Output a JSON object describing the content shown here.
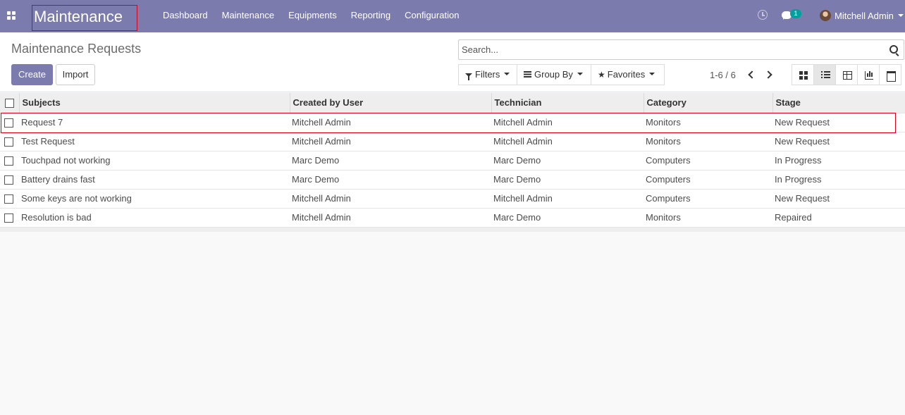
{
  "navbar": {
    "brand": "Maintenance",
    "menu": [
      "Dashboard",
      "Maintenance",
      "Equipments",
      "Reporting",
      "Configuration"
    ],
    "messages_count": "1",
    "user_name": "Mitchell Admin",
    "bg_color": "#7c7bad"
  },
  "control_panel": {
    "title": "Maintenance Requests",
    "create_label": "Create",
    "import_label": "Import",
    "search_placeholder": "Search...",
    "filters_label": "Filters",
    "groupby_label": "Group By",
    "favorites_label": "Favorites",
    "pager": "1-6 / 6",
    "views": [
      "kanban",
      "list",
      "pivot",
      "graph",
      "calendar"
    ],
    "active_view": "list"
  },
  "table": {
    "columns": [
      "Subjects",
      "Created by User",
      "Technician",
      "Category",
      "Stage"
    ],
    "rows": [
      [
        "Request 7",
        "Mitchell Admin",
        "Mitchell Admin",
        "Monitors",
        "New Request"
      ],
      [
        "Test Request",
        "Mitchell Admin",
        "Mitchell Admin",
        "Monitors",
        "New Request"
      ],
      [
        "Touchpad not working",
        "Marc Demo",
        "Marc Demo",
        "Computers",
        "In Progress"
      ],
      [
        "Battery drains fast",
        "Marc Demo",
        "Marc Demo",
        "Computers",
        "In Progress"
      ],
      [
        "Some keys are not working",
        "Mitchell Admin",
        "Mitchell Admin",
        "Computers",
        "New Request"
      ],
      [
        "Resolution is bad",
        "Mitchell Admin",
        "Marc Demo",
        "Monitors",
        "Repaired"
      ]
    ]
  }
}
